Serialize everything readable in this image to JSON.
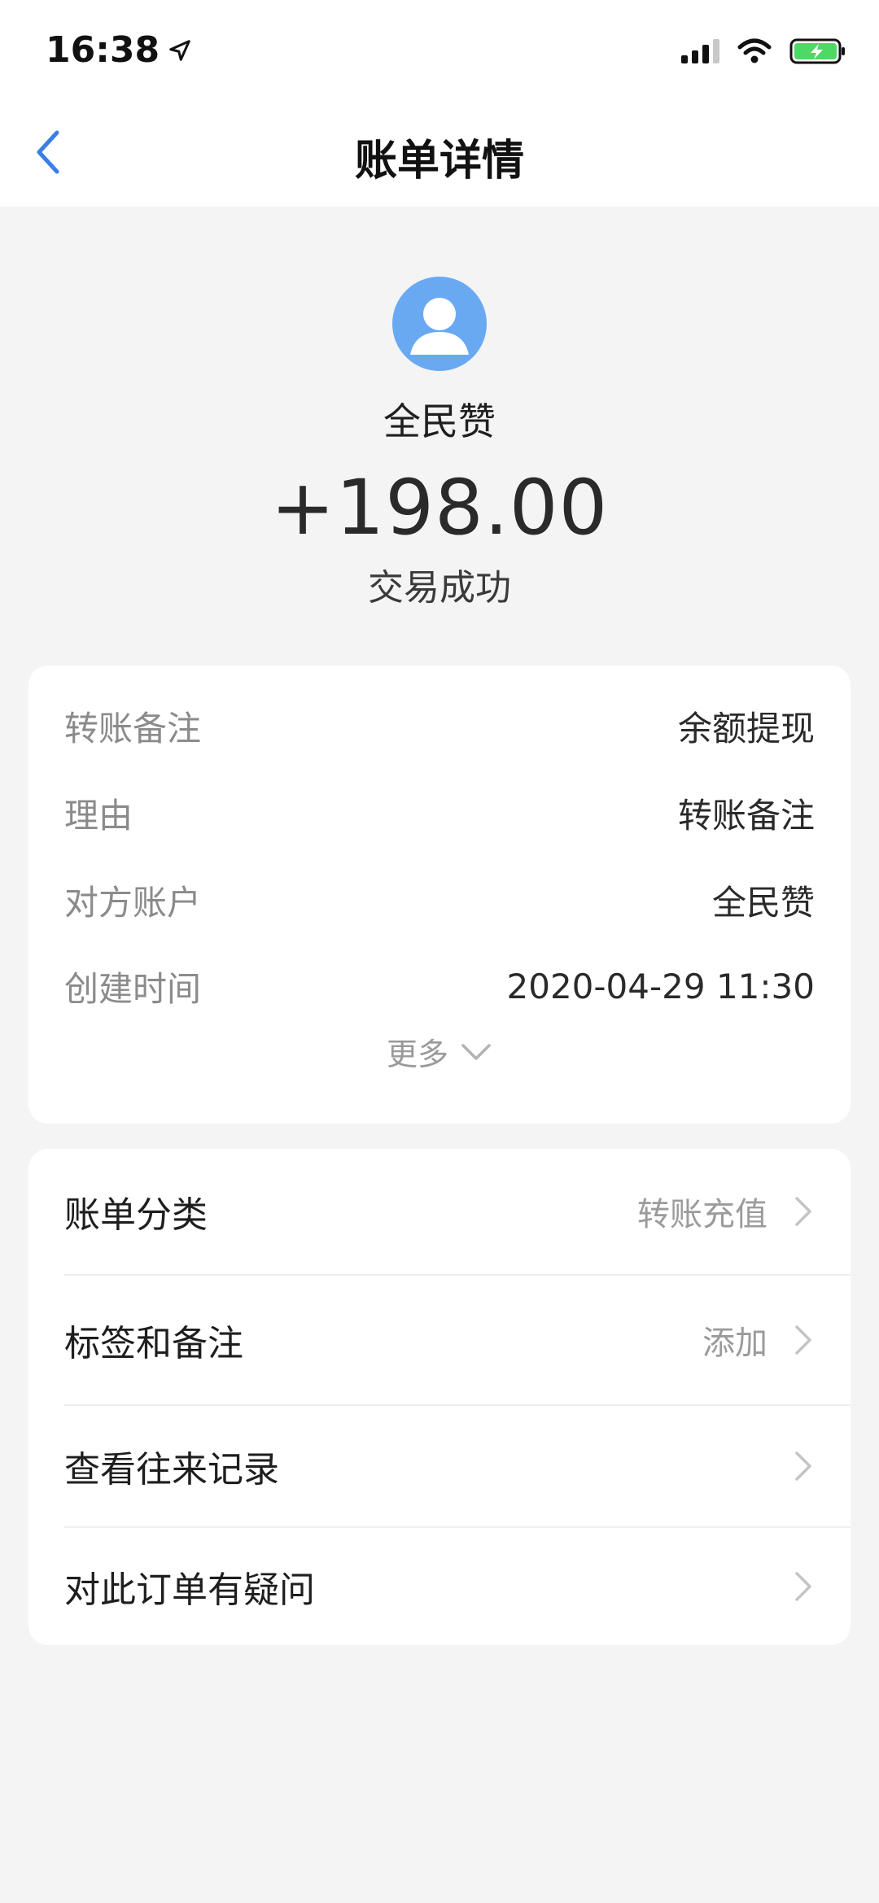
{
  "status_bar": {
    "time": "16:38",
    "icons": [
      "location-arrow-icon",
      "signal-icon",
      "wifi-icon",
      "battery-charging-icon"
    ]
  },
  "header": {
    "back_icon": "chevron-left-icon",
    "title": "账单详情"
  },
  "summary": {
    "payee_name": "全民赞",
    "amount": "+198.00",
    "status": "交易成功",
    "avatar_icon": "user-avatar-icon"
  },
  "details": {
    "rows": [
      {
        "label": "转账备注",
        "value": "余额提现"
      },
      {
        "label": "理由",
        "value": "转账备注"
      },
      {
        "label": "对方账户",
        "value": "全民赞"
      },
      {
        "label": "创建时间",
        "value": "2020-04-29 11:30"
      }
    ],
    "more_label": "更多"
  },
  "menu": {
    "items": [
      {
        "label": "账单分类",
        "value": "转账充值"
      },
      {
        "label": "标签和备注",
        "value": "添加"
      },
      {
        "label": "查看往来记录",
        "value": ""
      },
      {
        "label": "对此订单有疑问",
        "value": ""
      }
    ]
  },
  "colors": {
    "accent": "#3a7fe6",
    "avatar_bg": "#69a9f2",
    "battery_green": "#4cd964",
    "page_bg": "#f4f4f4"
  }
}
